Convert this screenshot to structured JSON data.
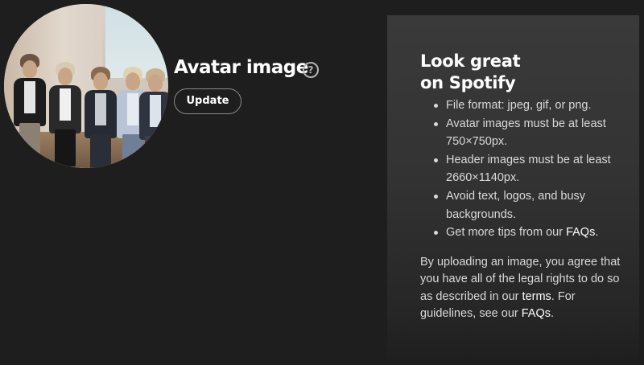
{
  "profile": {
    "heading": "Avatar image",
    "help_icon": "question-mark-icon",
    "update_label": "Update"
  },
  "tips": {
    "title_line1": "Look great",
    "title_line2": "on Spotify",
    "items": [
      {
        "text": "File format: jpeg, gif, or png."
      },
      {
        "text": "Avatar images must be at least 750×750px."
      },
      {
        "text": "Header images must be at least 2660×1140px."
      },
      {
        "text": "Avoid text, logos, and busy backgrounds."
      },
      {
        "text": "Get more tips from our ",
        "link": "FAQs",
        "after": "."
      }
    ],
    "consent": {
      "text_before": "By uploading an image, you agree that you have all of the legal rights to do so as described in our ",
      "terms_link": "terms",
      "text_middle": ". For guidelines, see our ",
      "faqs_link": "FAQs",
      "text_after": "."
    }
  },
  "colors": {
    "background": "#1e1e1e",
    "panel": "#333333",
    "text_primary": "#ffffff",
    "text_secondary": "#d9d9d9",
    "button_border": "#8a8a8a"
  }
}
